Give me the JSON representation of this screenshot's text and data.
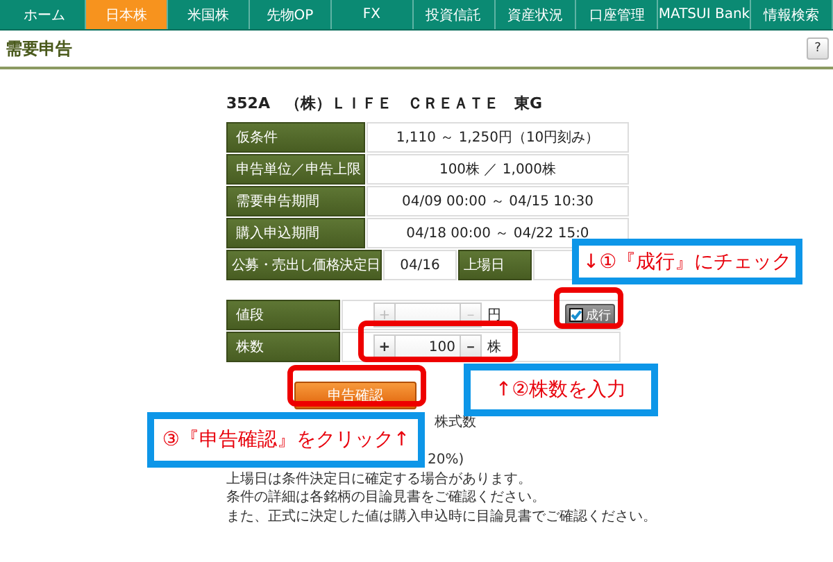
{
  "nav": {
    "tabs": [
      {
        "label": "ホーム",
        "selected": false
      },
      {
        "label": "日本株",
        "selected": true
      },
      {
        "label": "米国株",
        "selected": false
      },
      {
        "label": "先物OP",
        "selected": false
      },
      {
        "label": "FX",
        "selected": false
      },
      {
        "label": "投資信託",
        "selected": false
      },
      {
        "label": "資産状況",
        "selected": false
      },
      {
        "label": "口座管理",
        "selected": false
      },
      {
        "label": "MATSUI Bank",
        "selected": false
      },
      {
        "label": "情報検索",
        "selected": false
      }
    ]
  },
  "page": {
    "title": "需要申告",
    "help_button": "?"
  },
  "issue": {
    "heading": "352A　（株）ＬＩＦＥ　ＣＲＥＡＴＥ　東G",
    "details": [
      {
        "label": "仮条件",
        "value": "1,110 ～ 1,250円（10円刻み）"
      },
      {
        "label": "申告単位／申告上限",
        "value": "100株 ／ 1,000株"
      },
      {
        "label": "需要申告期間",
        "value": "04/09 00:00 ～ 04/15 10:30"
      },
      {
        "label": "購入申込期間",
        "value": "04/18 00:00 ～ 04/22 15:0"
      }
    ],
    "decision_date": {
      "label": "公募・売出し価格決定日",
      "value": "04/16"
    },
    "listing_date": {
      "label": "上場日"
    }
  },
  "order_form": {
    "rows": [
      {
        "label": "値段",
        "plus": "+",
        "minus": "－",
        "unit": "円",
        "disabled": true
      },
      {
        "label": "株数",
        "plus": "+",
        "value": "100",
        "minus": "－",
        "unit": "株",
        "disabled": false
      }
    ],
    "market_order": {
      "label": "成行",
      "checked": true
    }
  },
  "confirm_button": "申告確認",
  "notes": {
    "covered_fragments": [
      "株式数",
      "20%)"
    ],
    "lines": [
      "上場日は条件決定日に確定する場合があります。",
      "条件の詳細は各銘柄の目論見書をご確認ください。",
      "また、正式に決定した値は購入申込時に目論見書でご確認ください。"
    ]
  },
  "annotations": [
    {
      "text": "↓①『成行』にチェック"
    },
    {
      "text": "↑②株数を入力"
    },
    {
      "text": "③『申告確認』をクリック↑"
    }
  ]
}
